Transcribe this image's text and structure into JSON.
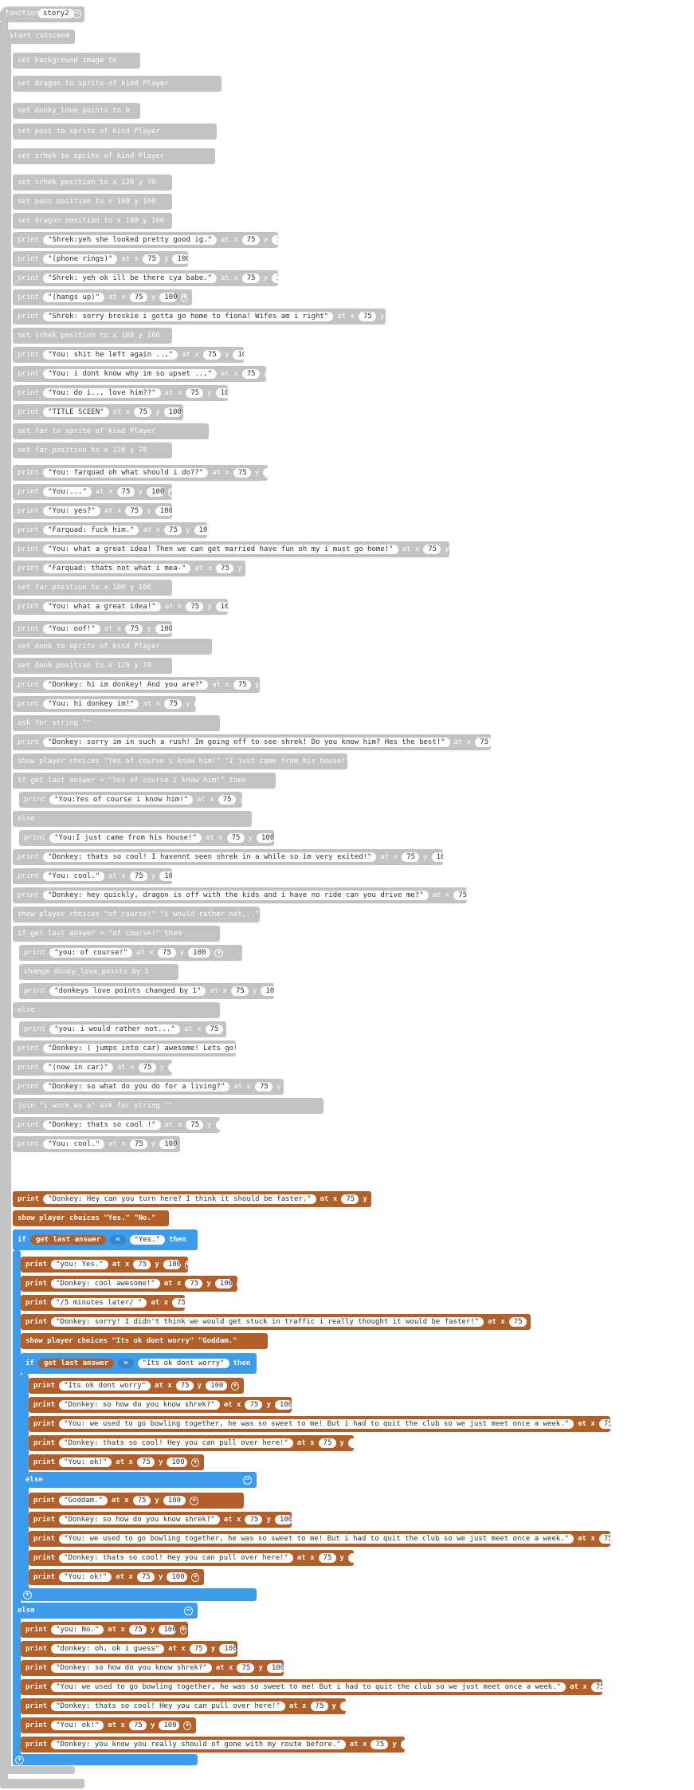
{
  "function_header": {
    "keyword": "function",
    "name": "story2"
  },
  "start_label": "start cutscene",
  "gray_blocks": [
    {
      "kind": "set",
      "text": "set background image to"
    },
    {
      "kind": "set",
      "text": "set dragon to sprite of kind Player"
    },
    {
      "kind": "set",
      "text": "set donky_love_points to 0"
    },
    {
      "kind": "set",
      "text": "set puss to sprite of kind Player"
    },
    {
      "kind": "set",
      "text": "set srhek to sprite of kind Player"
    },
    {
      "kind": "pos",
      "text": "set srhek position to x 120 y 70"
    },
    {
      "kind": "pos",
      "text": "set puss position to x 180 y 160"
    },
    {
      "kind": "pos",
      "text": "set dragon position to x 180 y 160"
    },
    {
      "kind": "print",
      "text": "\"Shrek:yeh she looked pretty good ig.\""
    },
    {
      "kind": "print",
      "text": "\"(phone rings)\""
    },
    {
      "kind": "print",
      "text": "\"Shrek: yeh ok ill be there cya babe.\""
    },
    {
      "kind": "print",
      "text": "\"(hangs up)\""
    },
    {
      "kind": "print",
      "text": "\"Shrek: sorry broskie i gotta go home to fiona! Wifes am i right\""
    },
    {
      "kind": "pos",
      "text": "set srhek position to x 180 y 160"
    },
    {
      "kind": "print",
      "text": "\"You: shit he left again ..,\""
    },
    {
      "kind": "print",
      "text": "\"You: i dont know why im so upset ..,\""
    },
    {
      "kind": "print",
      "text": "\"You: do i.., love him??\""
    },
    {
      "kind": "print",
      "text": "\"TITLE SCEEN\""
    },
    {
      "kind": "set",
      "text": "set far to sprite of kind Player"
    },
    {
      "kind": "pos",
      "text": "set far position to x 120 y 70"
    },
    {
      "kind": "print",
      "text": "\"You: farquad oh what should i do??\""
    },
    {
      "kind": "print",
      "text": "\"You:...\""
    },
    {
      "kind": "print",
      "text": "\"You: yes?\""
    },
    {
      "kind": "print",
      "text": "\"Farquad: fuck him.\""
    },
    {
      "kind": "print",
      "text": "\"You: what a great idea! Then we can get married have fun oh my i must go home!\""
    },
    {
      "kind": "print",
      "text": "\"Farquad: thats not what i mea-\""
    },
    {
      "kind": "pos",
      "text": "set far position to x 180 y 160"
    },
    {
      "kind": "print",
      "text": "\"You: what a great idea!\""
    },
    {
      "kind": "print",
      "text": "\"You: oof!\""
    },
    {
      "kind": "set",
      "text": "set donk to sprite of kind Player"
    },
    {
      "kind": "pos",
      "text": "set donk position to x 120 y 70"
    },
    {
      "kind": "print",
      "text": "\"Donkey: hi im donkey! And you are?\""
    },
    {
      "kind": "print",
      "text": "\"You: hi donkey im!\""
    },
    {
      "kind": "print",
      "text": "ask for string \"\""
    },
    {
      "kind": "print",
      "text": "\"Donkey: sorry im in such a rush! Im going off to see shrek! Do you know him? Hes the best!\""
    },
    {
      "kind": "choice",
      "text": "show player choices \"Yes of course i know him!\" \"I just came from his house!\""
    },
    {
      "kind": "if",
      "text": "if get last answer = \"Yes of course i know him!\" then"
    },
    {
      "kind": "print",
      "text": "\"You:Yes of course i know him!\""
    },
    {
      "kind": "else",
      "text": "else"
    },
    {
      "kind": "print",
      "text": "\"You:I just came from his house!\""
    },
    {
      "kind": "print",
      "text": "\"Donkey: thats so cool! I havennt seen shrek in a while so im very exited!\""
    },
    {
      "kind": "print",
      "text": "\"You: cool.\""
    },
    {
      "kind": "print",
      "text": "\"Donkey: hey quickly, dragon is off with the kids and i have no ride can you drive me?\""
    },
    {
      "kind": "choice",
      "text": "show player choices \"of course!\" \"i would rather not...\""
    },
    {
      "kind": "if",
      "text": "if get last answer = \"of course!\" then"
    },
    {
      "kind": "print",
      "text": "\"you: of course!\""
    },
    {
      "kind": "change",
      "text": "change donky_love_points by 1"
    },
    {
      "kind": "print",
      "text": "\"donkeys love points changed by 1\""
    },
    {
      "kind": "else",
      "text": "else"
    },
    {
      "kind": "print",
      "text": "\"you: i would rather not...\""
    },
    {
      "kind": "print",
      "text": "\"Donkey: ( jumps into car) awesome! Lets go!\""
    },
    {
      "kind": "print",
      "text": "\"(now in car)\""
    },
    {
      "kind": "print",
      "text": "\"Donkey: so what do you do for a living?\""
    },
    {
      "kind": "print",
      "text": "join \"i work as a\" ask for string \"\""
    },
    {
      "kind": "print",
      "text": "\"Donkey: thats so cool !\""
    },
    {
      "kind": "print",
      "text": "\"You: cool.\""
    }
  ],
  "orange_top": [
    {
      "kind": "print",
      "text": "\"Donkey: Hey can you turn here? I think it should be faster.\""
    },
    {
      "kind": "choice",
      "text": "show player choices \"Yes.\" \"No.\""
    }
  ],
  "if_block": {
    "keyword": "if",
    "answer": "get last answer",
    "op": "=",
    "value": "\"Yes.\"",
    "then": "then",
    "else": "else"
  },
  "print_xy": {
    "at": "at x",
    "x": "75",
    "y_label": "y",
    "y": "100"
  },
  "orange_then": [
    {
      "kind": "print",
      "text": "\"you: Yes.\""
    },
    {
      "kind": "print",
      "text": "\"Donkey: cool awesome!\""
    },
    {
      "kind": "print",
      "text": "\"/5 minutes later/ \""
    },
    {
      "kind": "print",
      "text": "\"Donkey: sorry! I didn't think we would get stuck in traffic i really thought it would be faster!\""
    },
    {
      "kind": "choice",
      "text": "show player choices \"Its ok dont worry\" \"Goddam.\""
    }
  ],
  "inner_if": {
    "keyword": "if",
    "answer": "get last answer",
    "op": "=",
    "value": "\"Its ok dont worry\"",
    "then": "then",
    "else": "else"
  },
  "inner_then": [
    "\"Its ok dont worry\"",
    "\"Donkey: so how do you know shrek?\"",
    "\"You: we used to go bowling together, he was so sweet to me! But i had to quit the club so we just meet once a week.\"",
    "\"Donkey: thats so cool! Hey you can pull over here!\"",
    "\"You: ok!\""
  ],
  "inner_else": [
    "\"Goddam.\"",
    "\"Donkey: so how do you know shrek?\"",
    "\"You: we used to go bowling together, he was so sweet to me! But i had to quit the club so we just meet once a week.\"",
    "\"Donkey: thats so cool! Hey you can pull over here!\"",
    "\"You: ok!\""
  ],
  "outer_else": [
    "\"you: No.\"",
    "\"donkey: oh, ok i guess\"",
    "\"Donkey: so how do you know shrek?\"",
    "\"You: we used to go bowling together, he was so sweet to me! But i had to quit the club so we just meet once a week.\"",
    "\"Donkey: thats so cool! Hey you can pull over here!\"",
    "\"You: ok!\"",
    "\"Donkey: you know you really should of gone with my route before.\""
  ],
  "colors": {
    "gray": "#c3c3c3",
    "orange": "#b35f2a",
    "blue": "#3c9bea"
  }
}
